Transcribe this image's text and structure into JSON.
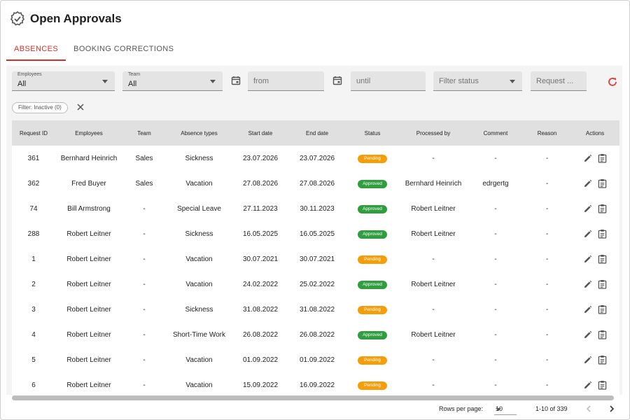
{
  "page": {
    "title": "Open Approvals"
  },
  "tabs": [
    {
      "label": "ABSENCES",
      "active": true
    },
    {
      "label": "BOOKING CORRECTIONS",
      "active": false
    }
  ],
  "filters": {
    "employees": {
      "label": "Employees",
      "value": "All"
    },
    "team": {
      "label": "Team",
      "value": "All"
    },
    "from": {
      "placeholder": "from"
    },
    "until": {
      "placeholder": "until"
    },
    "status": {
      "placeholder": "Filter status"
    },
    "request": {
      "placeholder": "Request ..."
    },
    "chip": "Filter: Inactive (0)"
  },
  "table": {
    "columns": [
      "Request ID",
      "Employees",
      "Team",
      "Absence types",
      "Start date",
      "End date",
      "Status",
      "Processed by",
      "Comment",
      "Reason",
      "Actions"
    ],
    "rows": [
      {
        "id": "361",
        "employee": "Bernhard Heinrich",
        "team": "Sales",
        "type": "Sickness",
        "start": "23.07.2026",
        "end": "23.07.2026",
        "status": "Pending",
        "processed": "-",
        "comment": "-",
        "reason": "-"
      },
      {
        "id": "362",
        "employee": "Fred Buyer",
        "team": "Sales",
        "type": "Vacation",
        "start": "27.08.2026",
        "end": "27.08.2026",
        "status": "Approved",
        "processed": "Bernhard Heinrich",
        "comment": "edrgertg",
        "reason": "-"
      },
      {
        "id": "74",
        "employee": "Bill Armstrong",
        "team": "-",
        "type": "Special Leave",
        "start": "27.11.2023",
        "end": "30.11.2023",
        "status": "Approved",
        "processed": "Robert Leitner",
        "comment": "-",
        "reason": "-"
      },
      {
        "id": "288",
        "employee": "Robert Leitner",
        "team": "-",
        "type": "Sickness",
        "start": "16.05.2025",
        "end": "16.05.2025",
        "status": "Approved",
        "processed": "Robert Leitner",
        "comment": "-",
        "reason": "-"
      },
      {
        "id": "1",
        "employee": "Robert Leitner",
        "team": "-",
        "type": "Vacation",
        "start": "30.07.2021",
        "end": "30.07.2021",
        "status": "Pending",
        "processed": "-",
        "comment": "-",
        "reason": "-"
      },
      {
        "id": "2",
        "employee": "Robert Leitner",
        "team": "-",
        "type": "Vacation",
        "start": "24.02.2022",
        "end": "25.02.2022",
        "status": "Approved",
        "processed": "Robert Leitner",
        "comment": "-",
        "reason": "-"
      },
      {
        "id": "3",
        "employee": "Robert Leitner",
        "team": "-",
        "type": "Sickness",
        "start": "31.08.2022",
        "end": "31.08.2022",
        "status": "Pending",
        "processed": "-",
        "comment": "-",
        "reason": "-"
      },
      {
        "id": "4",
        "employee": "Robert Leitner",
        "team": "-",
        "type": "Short-Time Work",
        "start": "26.08.2022",
        "end": "26.08.2022",
        "status": "Approved",
        "processed": "Robert Leitner",
        "comment": "-",
        "reason": "-"
      },
      {
        "id": "5",
        "employee": "Robert Leitner",
        "team": "-",
        "type": "Vacation",
        "start": "01.09.2022",
        "end": "01.09.2022",
        "status": "Pending",
        "processed": "-",
        "comment": "-",
        "reason": "-"
      },
      {
        "id": "6",
        "employee": "Robert Leitner",
        "team": "-",
        "type": "Vacation",
        "start": "15.09.2022",
        "end": "16.09.2022",
        "status": "Pending",
        "processed": "-",
        "comment": "-",
        "reason": "-"
      }
    ]
  },
  "pagination": {
    "rows_per_page_label": "Rows per page:",
    "rows_per_page": "10",
    "range": "1-10 of 339"
  },
  "colors": {
    "accent": "#d32f2f",
    "pending": "#f59e0b",
    "approved": "#2e9e3e"
  }
}
